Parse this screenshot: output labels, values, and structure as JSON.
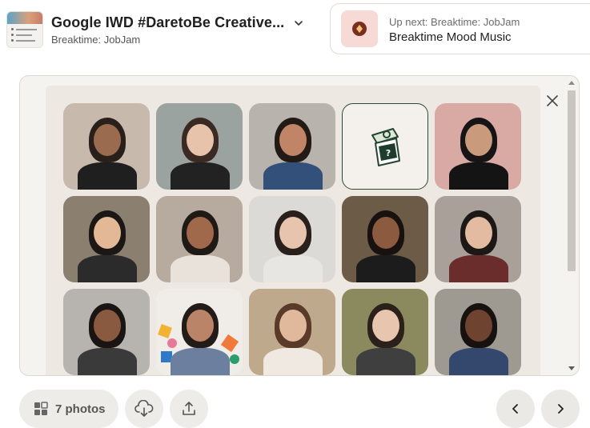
{
  "header": {
    "title": "Google IWD #DaretoBe Creative...",
    "subtitle": "Breaktime: JobJam",
    "thumbnail_icon": "event-thumbnail"
  },
  "up_next": {
    "label": "Up next: Breaktime: JobJam",
    "name": "Breaktime Mood Music",
    "art_icon": "music-diamond-icon",
    "art_color": "#f7d9d6"
  },
  "gallery": {
    "close_icon": "close-icon",
    "placeholder_icon": "photo-booth-camera-icon",
    "tiles": [
      {
        "kind": "photo",
        "bg": "#c7b9ab",
        "skin": "#9a6b4e",
        "hair": "#2a201b",
        "shirt": "#1f1f1f"
      },
      {
        "kind": "photo",
        "bg": "#9aa3a0",
        "skin": "#e8c3ab",
        "hair": "#3a2a22",
        "shirt": "#222222"
      },
      {
        "kind": "photo",
        "bg": "#b9b3ad",
        "skin": "#c08566",
        "hair": "#231915",
        "shirt": "#33507a"
      },
      {
        "kind": "placeholder"
      },
      {
        "kind": "photo",
        "bg": "#d9a9a3",
        "skin": "#c99a7c",
        "hair": "#161414",
        "shirt": "#141414"
      },
      {
        "kind": "photo",
        "bg": "#8b7f70",
        "skin": "#e2b896",
        "hair": "#1a1715",
        "shirt": "#2b2b2b"
      },
      {
        "kind": "photo",
        "bg": "#b7aa9e",
        "skin": "#a1694c",
        "hair": "#201a17",
        "shirt": "#e9e2da"
      },
      {
        "kind": "photo",
        "bg": "#dcdad6",
        "skin": "#e6c4ad",
        "hair": "#2a201b",
        "shirt": "#e8e6e3"
      },
      {
        "kind": "photo",
        "bg": "#6c5c47",
        "skin": "#8b5a3f",
        "hair": "#17120f",
        "shirt": "#1c1c1c"
      },
      {
        "kind": "photo",
        "bg": "#a9a09a",
        "skin": "#e2bba0",
        "hair": "#1c1816",
        "shirt": "#6a2d2b"
      },
      {
        "kind": "photo",
        "bg": "#b7b3ae",
        "skin": "#8a5a40",
        "hair": "#1a1512",
        "shirt": "#3a3a3a"
      },
      {
        "kind": "photo",
        "bg": "#f0ece8",
        "skin": "#b98468",
        "hair": "#231b17",
        "shirt": "#6c7f9e",
        "confetti": true
      },
      {
        "kind": "photo",
        "bg": "#bfa98c",
        "skin": "#e0b89b",
        "hair": "#5a3a28",
        "shirt": "#efe9e2"
      },
      {
        "kind": "photo",
        "bg": "#8a8a5e",
        "skin": "#e8c5ae",
        "hair": "#2b201a",
        "shirt": "#3f3f3f"
      },
      {
        "kind": "photo",
        "bg": "#9f9a91",
        "skin": "#6e4430",
        "hair": "#171210",
        "shirt": "#34486e"
      }
    ]
  },
  "footer": {
    "photos_label": "7 photos",
    "grid_icon": "grid-icon",
    "download_icon": "cloud-download-icon",
    "share_icon": "share-upload-icon",
    "prev_icon": "chevron-left-icon",
    "next_icon": "chevron-right-icon"
  }
}
